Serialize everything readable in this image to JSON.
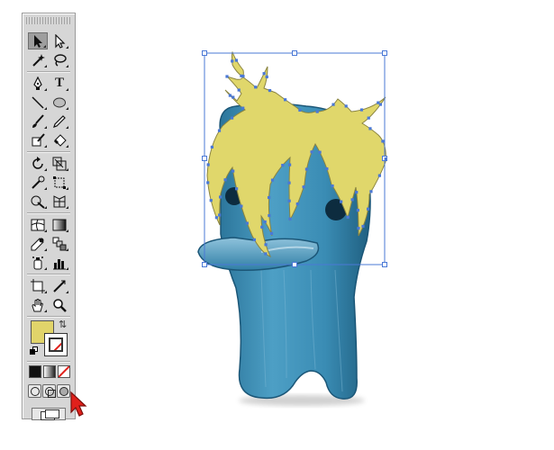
{
  "toolbox": {
    "tools": [
      {
        "name": "selection-tool",
        "icon": "arrow-icon"
      },
      {
        "name": "direct-selection-tool",
        "icon": "hollow-arrow-icon"
      },
      {
        "name": "magic-wand-tool",
        "icon": "magic-wand-icon"
      },
      {
        "name": "lasso-tool",
        "icon": "lasso-icon"
      },
      {
        "name": "pen-tool",
        "icon": "pen-icon"
      },
      {
        "name": "type-tool",
        "icon": "type-icon",
        "glyph": "T"
      },
      {
        "name": "line-segment-tool",
        "icon": "line-icon"
      },
      {
        "name": "ellipse-tool",
        "icon": "ellipse-icon"
      },
      {
        "name": "paintbrush-tool",
        "icon": "brush-icon"
      },
      {
        "name": "pencil-tool",
        "icon": "pencil-icon"
      },
      {
        "name": "blob-brush-tool",
        "icon": "blob-brush-icon"
      },
      {
        "name": "eraser-tool",
        "icon": "eraser-icon"
      },
      {
        "name": "rotate-tool",
        "icon": "rotate-icon"
      },
      {
        "name": "scale-tool",
        "icon": "scale-icon"
      },
      {
        "name": "warp-tool",
        "icon": "warp-icon"
      },
      {
        "name": "free-transform-tool",
        "icon": "free-transform-icon"
      },
      {
        "name": "shape-builder-tool",
        "icon": "shape-builder-icon"
      },
      {
        "name": "perspective-grid-tool",
        "icon": "perspective-grid-icon"
      },
      {
        "name": "mesh-tool",
        "icon": "mesh-icon"
      },
      {
        "name": "gradient-tool",
        "icon": "gradient-icon"
      },
      {
        "name": "eyedropper-tool",
        "icon": "eyedropper-icon"
      },
      {
        "name": "blend-tool",
        "icon": "blend-icon"
      },
      {
        "name": "symbol-sprayer-tool",
        "icon": "symbol-sprayer-icon"
      },
      {
        "name": "column-graph-tool",
        "icon": "column-graph-icon"
      },
      {
        "name": "artboard-tool",
        "icon": "artboard-icon"
      },
      {
        "name": "slice-tool",
        "icon": "slice-icon"
      },
      {
        "name": "hand-tool",
        "icon": "hand-icon"
      },
      {
        "name": "zoom-tool",
        "icon": "zoom-icon"
      }
    ],
    "fill_color": "#e1d46a",
    "stroke_color": "none",
    "accent_red": "#e0201b"
  },
  "artwork": {
    "hair_color": "#e0d76b",
    "body_color": "#3b8fb6",
    "body_dark": "#1e5f80",
    "eye_color": "#0d2c3f",
    "selection_color": "#4a78d6"
  }
}
